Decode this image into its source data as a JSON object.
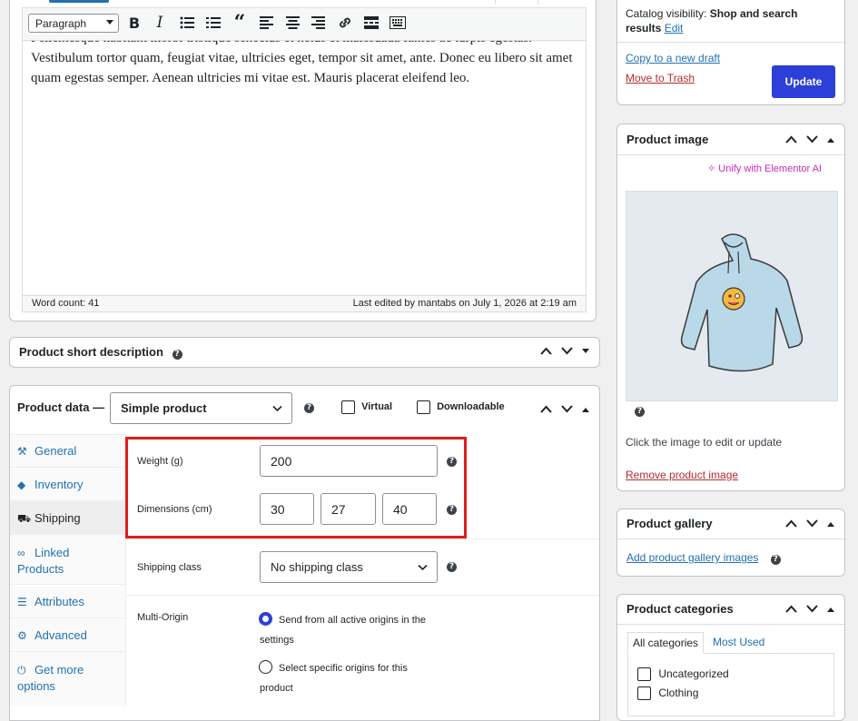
{
  "editor": {
    "format_select": "Paragraph",
    "content_clipped": "Pellentesque habitant morbi tristique senectus et netus et malesuada fames ac turpis egestas.",
    "content": "Vestibulum tortor quam, feugiat vitae, ultricies eget, tempor sit amet, ante. Donec eu libero sit amet quam egestas semper. Aenean ultricies mi vitae est. Mauris placerat eleifend leo.",
    "word_count": "Word count: 41",
    "last_edited": "Last edited by mantabs on July 1, 2026 at 2:19 am"
  },
  "short_description": {
    "title": "Product short description"
  },
  "product_data": {
    "title": "Product data —",
    "type_select": "Simple product",
    "virtual_label": "Virtual",
    "downloadable_label": "Downloadable",
    "tabs": [
      {
        "label": "General",
        "icon": "wrench-icon"
      },
      {
        "label": "Inventory",
        "icon": "tag-icon"
      },
      {
        "label": "Shipping",
        "icon": "truck-icon"
      },
      {
        "label": "Linked Products",
        "icon": "link-icon"
      },
      {
        "label": "Attributes",
        "icon": "list-icon"
      },
      {
        "label": "Advanced",
        "icon": "gear-icon"
      },
      {
        "label": "Get more options",
        "icon": "plugin-icon"
      }
    ],
    "shipping": {
      "weight_label": "Weight (g)",
      "weight_value": "200",
      "dimensions_label": "Dimensions (cm)",
      "length": "30",
      "width": "27",
      "height": "40",
      "shipping_class_label": "Shipping class",
      "shipping_class_value": "No shipping class",
      "multi_origin_label": "Multi-Origin",
      "origin_option_1": "Send from all active origins in the settings",
      "origin_option_2": "Select specific origins for this product"
    }
  },
  "publish": {
    "catalog_visibility_label": "Catalog visibility:",
    "catalog_visibility_value": "Shop and search results",
    "edit_link": "Edit",
    "copy_draft": "Copy to a new draft",
    "move_trash": "Move to Trash",
    "update_button": "Update"
  },
  "product_image": {
    "title": "Product image",
    "elementor_link": "Unify with Elementor AI",
    "hint": "Click the image to edit or update",
    "remove_link": "Remove product image"
  },
  "product_gallery": {
    "title": "Product gallery",
    "add_link": "Add product gallery images"
  },
  "product_categories": {
    "title": "Product categories",
    "tab_all": "All categories",
    "tab_most_used": "Most Used",
    "items": [
      "Uncategorized",
      "Clothing"
    ]
  },
  "colors": {
    "accent": "#2271b1",
    "update_button": "#2c3fd8",
    "highlight": "#e21d1d",
    "elementor": "#c52bb5",
    "danger": "#b32d2e"
  }
}
